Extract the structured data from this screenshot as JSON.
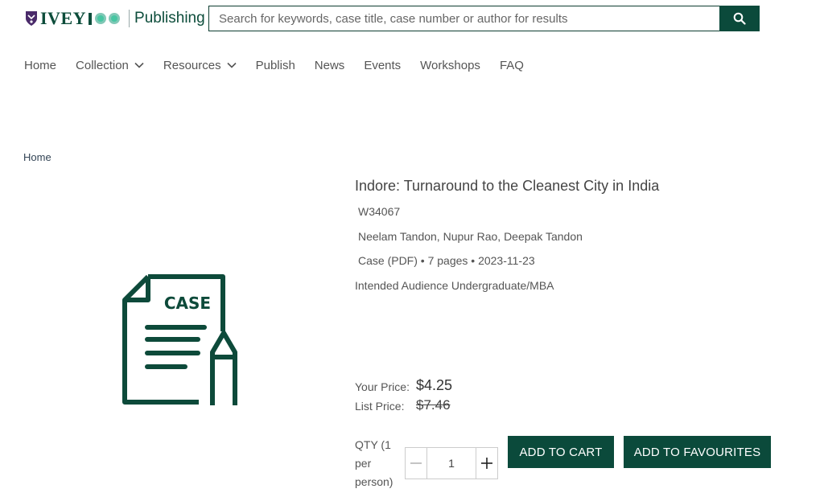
{
  "header": {
    "logo_brand": "IVEY",
    "logo_number": "100",
    "logo_publishing": "Publishing",
    "search_placeholder": "Search for keywords, case title, case number or author for results",
    "search_icon": "search-icon",
    "accent_color": "#0b4a3b"
  },
  "nav": {
    "items": [
      {
        "label": "Home"
      },
      {
        "label": "Collection",
        "icon": "chevron-down-icon"
      },
      {
        "label": "Resources",
        "icon": "chevron-down-icon"
      },
      {
        "label": "Publish"
      },
      {
        "label": "News"
      },
      {
        "label": "Events"
      },
      {
        "label": "Workshops"
      },
      {
        "label": "FAQ"
      }
    ]
  },
  "breadcrumb": {
    "home": "Home"
  },
  "product": {
    "image_icon": "case-document-icon",
    "image_text": "CASE",
    "title": "Indore: Turnaround to the Cleanest City in India",
    "code": "W34067",
    "authors": "Neelam Tandon, Nupur Rao, Deepak Tandon",
    "format": "Case (PDF) • 7 pages • 2023-11-23",
    "audience": "Intended Audience Undergraduate/MBA",
    "your_price_label": "Your Price:",
    "your_price": "$4.25",
    "list_price_label": "List Price:",
    "list_price": "$7.46",
    "qty_label": "QTY (1 per person)",
    "qty_value": "1",
    "add_to_cart": "ADD TO CART",
    "add_to_favourites": "ADD TO FAVOURITES"
  }
}
